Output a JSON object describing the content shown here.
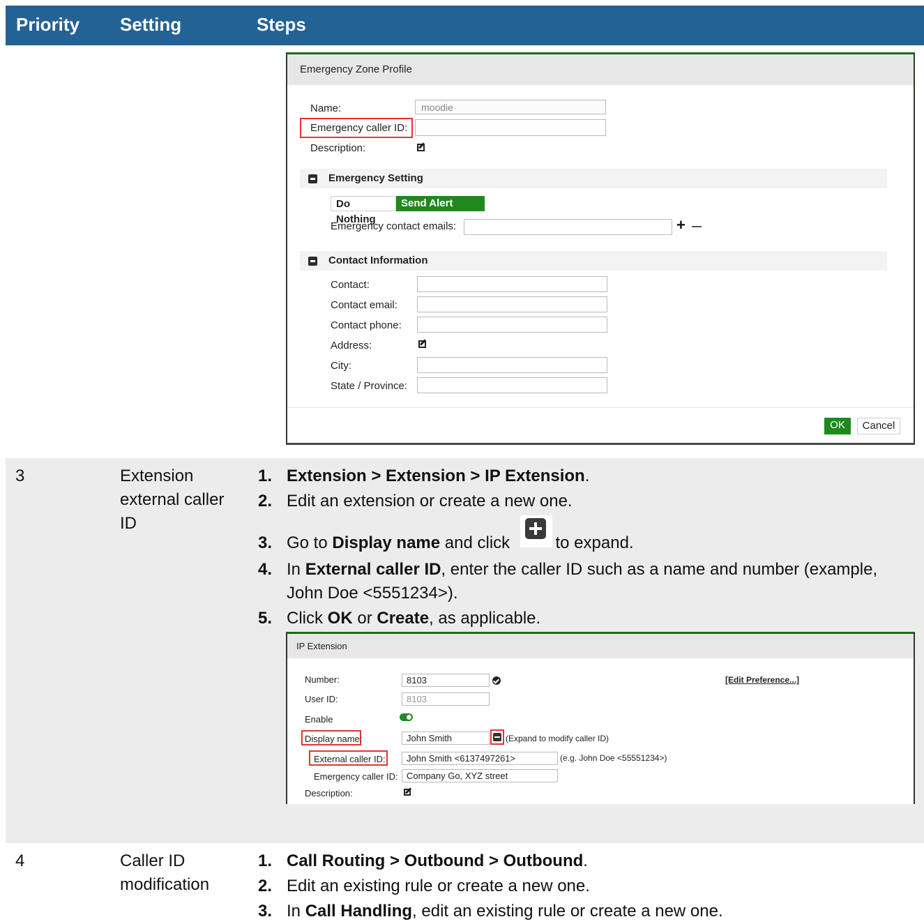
{
  "table": {
    "headers": [
      "Priority",
      "Setting",
      "Steps"
    ],
    "rows": [
      {
        "priority": "3",
        "setting": "Extension external caller ID",
        "steps": [
          {
            "num": "1.",
            "bold": "Extension > Extension > IP Extension",
            "after": "."
          },
          {
            "num": "2.",
            "text": "Edit an extension or create a new one."
          },
          {
            "num": "3.",
            "pre": "Go to ",
            "bold": "Display name",
            "mid": " and click ",
            "after": " to expand."
          },
          {
            "num": "4.",
            "pre": "In ",
            "bold": "External caller ID",
            "after": ", enter the caller ID such as a name and number (example,",
            "line2": "John Doe <5551234>)."
          },
          {
            "num": "5.",
            "pre": "Click ",
            "bold": "OK",
            "mid": " or ",
            "bold2": "Create",
            "after": ", as applicable."
          }
        ]
      },
      {
        "priority": "4",
        "setting": "Caller ID modification",
        "steps": [
          {
            "num": "1.",
            "bold": "Call Routing > Outbound > Outbound",
            "after": "."
          },
          {
            "num": "2.",
            "text": "Edit an existing rule or create a new one."
          },
          {
            "num": "3.",
            "pre": "In ",
            "bold": "Call Handling",
            "after": ", edit an existing rule or create a new one."
          }
        ]
      }
    ]
  },
  "emergency_dialog": {
    "title": "Emergency Zone Profile",
    "name_label": "Name:",
    "name_value": "moodie",
    "caller_id_label": "Emergency caller ID:",
    "description_label": "Description:",
    "emergency_setting_header": "Emergency Setting",
    "do_nothing": "Do Nothing",
    "send_alert": "Send Alert Email",
    "contact_emails_label": "Emergency contact emails:",
    "contact_info_header": "Contact Information",
    "contact_label": "Contact:",
    "contact_email_label": "Contact email:",
    "contact_phone_label": "Contact phone:",
    "address_label": "Address:",
    "city_label": "City:",
    "state_label": "State / Province:",
    "ok": "OK",
    "cancel": "Cancel"
  },
  "ip_extension_dialog": {
    "title": "IP Extension",
    "number_label": "Number:",
    "number_value": "8103",
    "edit_pref": "[Edit Preference...]",
    "userid_label": "User ID:",
    "userid_value": "8103",
    "enable_label": "Enable",
    "display_name_label": "Display name:",
    "display_name_value": "John Smith",
    "expand_hint": "(Expand to modify caller ID)",
    "external_caller_label": "External caller ID:",
    "external_caller_value": "John Smith <6137497261>",
    "external_hint": "(e.g. John Doe <55551234>)",
    "emergency_caller_label": "Emergency caller ID:",
    "emergency_caller_value": "Company Go, XYZ street",
    "description_label": "Description:"
  },
  "colors": {
    "header_bg": "#236295",
    "row_alt_bg": "#ececec",
    "green": "#1e8a1e",
    "highlight": "#e03535"
  }
}
